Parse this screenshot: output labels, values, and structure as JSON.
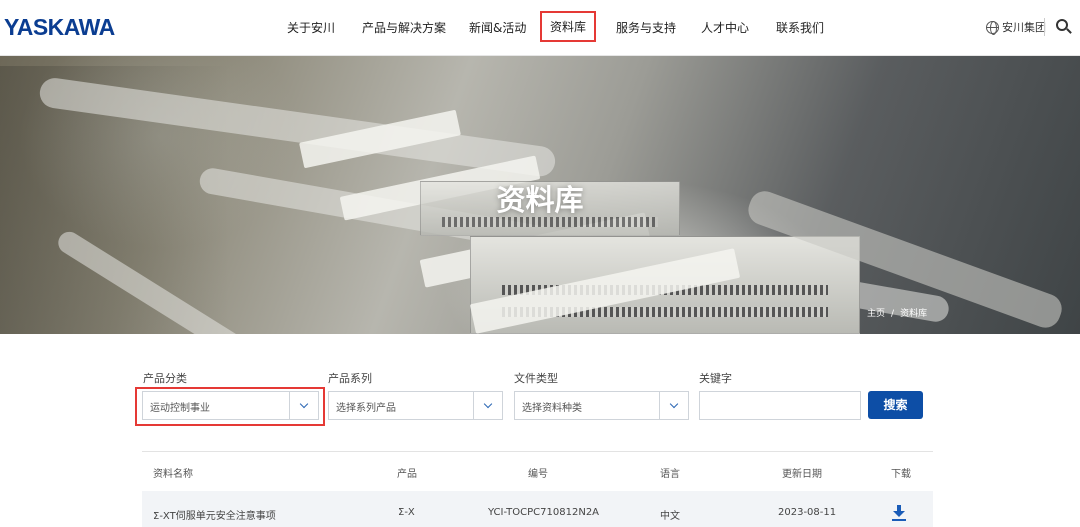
{
  "header": {
    "logo": "YASKAWA",
    "nav": [
      {
        "label": "关于安川"
      },
      {
        "label": "产品与解决方案"
      },
      {
        "label": "新闻&活动"
      },
      {
        "label": "资料库",
        "active": true
      },
      {
        "label": "服务与支持"
      },
      {
        "label": "人才中心"
      },
      {
        "label": "联系我们"
      }
    ],
    "lang_label": "安川集团",
    "icons": {
      "lang": "globe-icon",
      "search": "search-icon"
    }
  },
  "hero": {
    "title": "资料库",
    "breadcrumb": {
      "home": "主页",
      "separator": "/",
      "current": "资料库"
    }
  },
  "filters": {
    "category": {
      "label": "产品分类",
      "value": "运动控制事业"
    },
    "series": {
      "label": "产品系列",
      "placeholder": "选择系列产品"
    },
    "filetype": {
      "label": "文件类型",
      "placeholder": "选择资料种类"
    },
    "keyword": {
      "label": "关键字",
      "value": ""
    },
    "search_button": "搜索"
  },
  "table": {
    "columns": [
      "资料名称",
      "产品",
      "编号",
      "语言",
      "更新日期",
      "下载"
    ],
    "rows": [
      {
        "name": "Σ-XT伺服单元安全注意事项",
        "product": "Σ-X",
        "code": "YCI-TOCPC710812N2A",
        "language": "中文",
        "date": "2023-08-11",
        "download_icon": "download-icon"
      }
    ]
  },
  "colors": {
    "brand": "#0b3d91",
    "primary": "#0d4ea6",
    "highlight": "#e53935"
  }
}
